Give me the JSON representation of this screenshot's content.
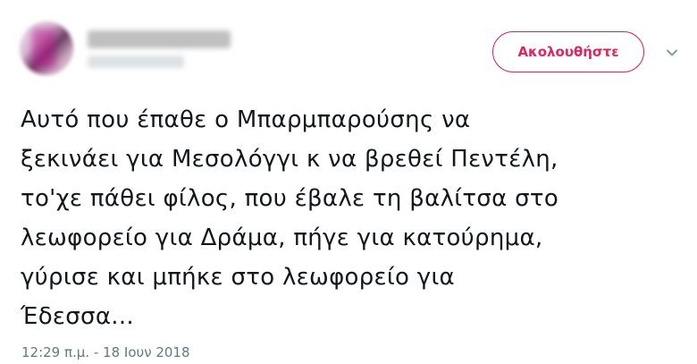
{
  "author": {
    "display_name": "",
    "handle": ""
  },
  "follow_button": {
    "label": "Ακολουθήστε",
    "accent_color": "#e0245e"
  },
  "menu": {
    "icon": "chevron-down-icon"
  },
  "tweet": {
    "lines": [
      "Αυτό που έπαθε ο Μπαρμπαρούσης να",
      "ξεκινάει για Μεσολόγγι κ να βρεθεί Πεντέλη,",
      "το'χε πάθει φίλος, που έβαλε τη βαλίτσα στο",
      "λεωφορείο για Δράμα, πήγε για κατούρημα,",
      "γύρισε και μπήκε στο λεωφορείο για",
      "Έδεσσα..."
    ],
    "timestamp": "12:29 π.μ. - 18 Ιουν 2018"
  }
}
